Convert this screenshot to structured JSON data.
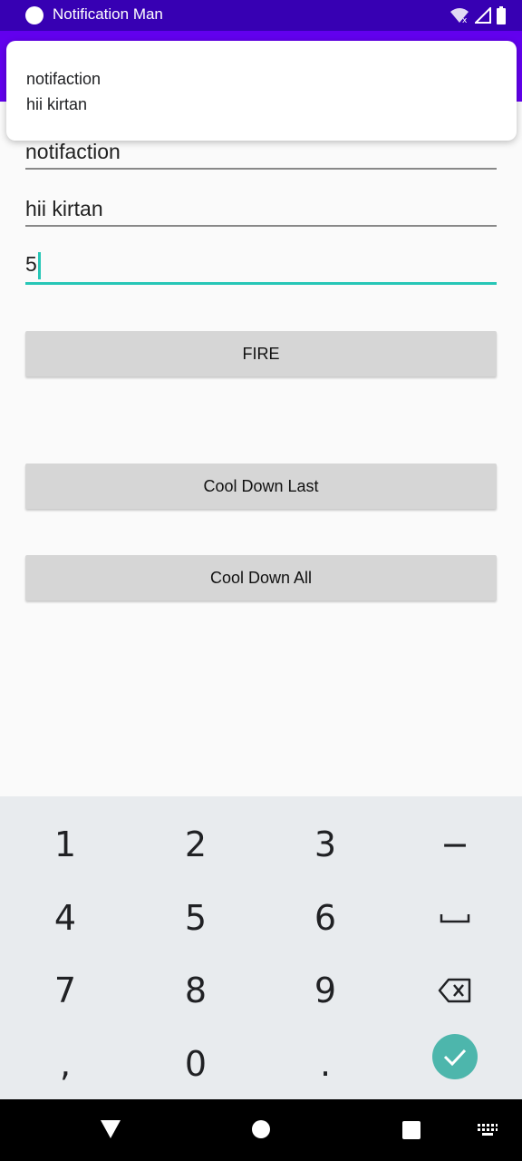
{
  "status_bar": {
    "app_title": "Notification Man"
  },
  "notification": {
    "title": "notifaction",
    "body": "hii kirtan"
  },
  "form": {
    "title_value": "notifaction",
    "message_value": "hii kirtan",
    "delay_value": "5",
    "accent_color": "#26c6b6"
  },
  "buttons": {
    "fire": "FIRE",
    "cool_down_last": "Cool Down Last",
    "cool_down_all": "Cool Down All"
  },
  "keyboard": {
    "keys": [
      [
        "1",
        "2",
        "3",
        "−"
      ],
      [
        "4",
        "5",
        "6",
        "space-icon"
      ],
      [
        "7",
        "8",
        "9",
        "backspace-icon"
      ],
      [
        ",",
        "0",
        ".",
        "enter-icon"
      ]
    ],
    "enter_color": "#4db6ac"
  },
  "colors": {
    "status_bar": "#3700b3",
    "app_bar": "#6200ee",
    "button_bg": "#d6d6d6"
  }
}
